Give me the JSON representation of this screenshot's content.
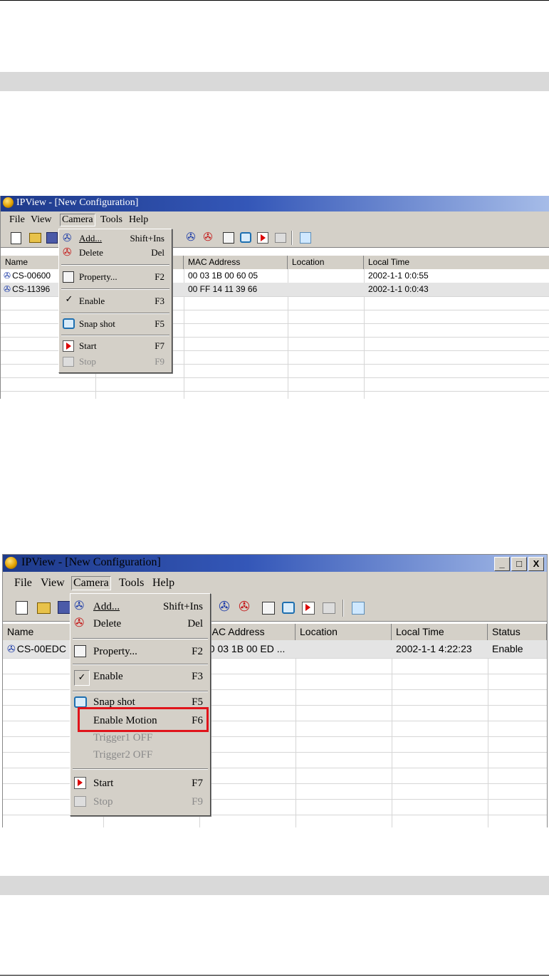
{
  "window1": {
    "title": "IPView - [New Configuration]",
    "menu": [
      "File",
      "View",
      "Camera",
      "Tools",
      "Help"
    ],
    "columns": [
      "Name",
      "MAC Address",
      "Location",
      "Local Time"
    ],
    "rows": [
      {
        "name": "CS-00600",
        "mac": "00 03 1B 00 60 05",
        "location": "",
        "time": "2002-1-1  0:0:55"
      },
      {
        "name": "CS-11396",
        "mac": "00 FF 14 11 39 66",
        "location": "",
        "time": "2002-1-1  0:0:43"
      }
    ],
    "camera_menu": [
      {
        "icon": "camera-add-icon",
        "label": "Add...",
        "shortcut": "Shift+Ins"
      },
      {
        "icon": "camera-delete-icon",
        "label": "Delete",
        "shortcut": "Del"
      },
      {
        "icon": "property-icon",
        "label": "Property...",
        "shortcut": "F2"
      },
      {
        "icon": "checkmark-icon",
        "label": "Enable",
        "shortcut": "F3"
      },
      {
        "icon": "snapshot-icon",
        "label": "Snap shot",
        "shortcut": "F5"
      },
      {
        "icon": "start-icon",
        "label": "Start",
        "shortcut": "F7"
      },
      {
        "icon": "stop-icon",
        "label": "Stop",
        "shortcut": "F9",
        "disabled": true
      }
    ]
  },
  "window2": {
    "title": "IPView - [New Configuration]",
    "menu": [
      "File",
      "View",
      "Camera",
      "Tools",
      "Help"
    ],
    "window_buttons": [
      "_",
      "□",
      "X"
    ],
    "columns": [
      "Name",
      "MAC Address",
      "Location",
      "Local Time",
      "Status"
    ],
    "rows": [
      {
        "name": "CS-00EDC",
        "mac": "00 03 1B 00 ED ...",
        "location": "",
        "time": "2002-1-1  4:22:23",
        "status": "Enable"
      }
    ],
    "camera_menu": [
      {
        "icon": "camera-add-icon",
        "label": "Add...",
        "shortcut": "Shift+Ins"
      },
      {
        "icon": "camera-delete-icon",
        "label": "Delete",
        "shortcut": "Del"
      },
      {
        "icon": "property-icon",
        "label": "Property...",
        "shortcut": "F2"
      },
      {
        "icon": "checkmark-icon",
        "label": "Enable",
        "shortcut": "F3"
      },
      {
        "icon": "snapshot-icon",
        "label": "Snap shot",
        "shortcut": "F5"
      },
      {
        "icon": "",
        "label": "Enable Motion",
        "shortcut": "F6"
      },
      {
        "icon": "",
        "label": "Trigger1 OFF",
        "shortcut": "",
        "disabled": true
      },
      {
        "icon": "",
        "label": "Trigger2 OFF",
        "shortcut": "",
        "disabled": true
      },
      {
        "icon": "start-icon",
        "label": "Start",
        "shortcut": "F7"
      },
      {
        "icon": "stop-icon",
        "label": "Stop",
        "shortcut": "F9",
        "disabled": true
      }
    ],
    "highlight_color": "#e0141b"
  },
  "colors": {
    "title_gradient_start": "#1e3a8a",
    "title_gradient_end": "#a6bce8",
    "menu_face": "#d4d0c8",
    "section_band": "#d9d9d9"
  }
}
